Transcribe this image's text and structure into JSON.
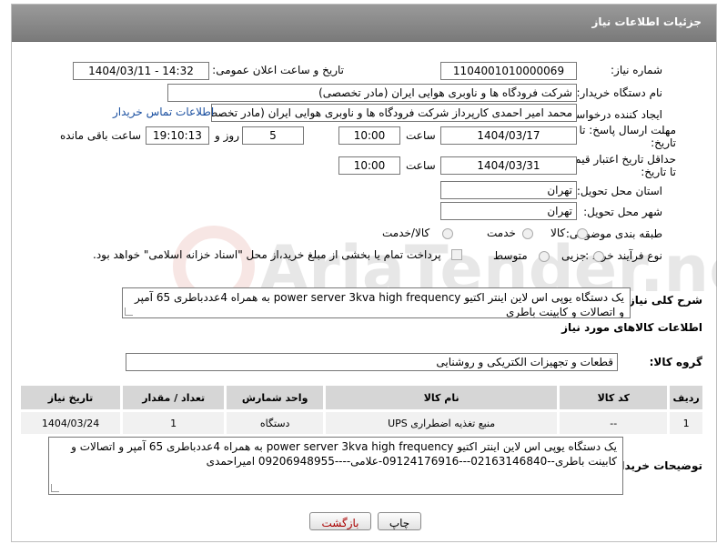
{
  "header": {
    "title": "جزئیات اطلاعات نیاز"
  },
  "form": {
    "need_number_label": "شماره نیاز:",
    "need_number": "1104001010000069",
    "announce_label": "تاریخ و ساعت اعلان عمومی:",
    "announce_value": "1404/03/11 - 14:32",
    "buyer_label": "نام دستگاه خریدار:",
    "buyer_value": "شرکت فرودگاه ها و ناوبری هوایی ایران (مادر تخصصی)",
    "requester_label": "ایجاد کننده درخواست:",
    "requester_value": "محمد امیر احمدی کارپرداز شرکت فرودگاه ها و ناوبری هوایی ایران (مادر تخصصی)",
    "contact_link": "اطلاعات تماس خریدار",
    "deadline_label": "مهلت ارسال پاسخ: تا تاریخ:",
    "deadline_date": "1404/03/17",
    "time_label": "ساعت",
    "deadline_time": "10:00",
    "days_value": "5",
    "days_label": "روز و",
    "remaining_time": "19:10:13",
    "remaining_label": "ساعت باقی مانده",
    "validity_label": "حداقل تاریخ اعتبار قیمت: تا تاریخ:",
    "validity_date": "1404/03/31",
    "validity_time_label": "ساعت",
    "validity_time": "10:00",
    "province_label": "استان محل تحویل:",
    "province_value": "تهران",
    "city_label": "شهر محل تحویل:",
    "city_value": "تهران",
    "category_label": "طبقه بندی موضوعی:",
    "category_options": [
      "کالا",
      "خدمت",
      "کالا/خدمت"
    ],
    "process_label": "نوع فرآیند خرید :",
    "process_options": [
      "جزیی",
      "متوسط"
    ],
    "payment_note": "پرداخت تمام یا بخشی از مبلغ خرید،از محل \"اسناد خزانه اسلامی\" خواهد بود."
  },
  "summary": {
    "label": "شرح کلی نیاز:",
    "text": "یک دستگاه یوپی اس لاین اینتر اکتیو power server 3kva high frequency به همراه 4عددباطری 65 آمپر و اتصالات و کابینت باطری"
  },
  "goods": {
    "section_title": "اطلاعات کالاهای مورد نیاز",
    "group_label": "گروه کالا:",
    "group_value": "قطعات و تجهیزات الکتریکی و روشنایی",
    "columns": [
      "ردیف",
      "کد کالا",
      "نام کالا",
      "واحد شمارش",
      "تعداد / مقدار",
      "تاریخ نیاز"
    ],
    "rows": [
      {
        "row": "1",
        "code": "--",
        "name": "منبع تغذیه اضطراری UPS",
        "unit": "دستگاه",
        "qty": "1",
        "date": "1404/03/24"
      }
    ]
  },
  "buyer_notes": {
    "label": "توضیحات خریدار:",
    "text": "یک دستگاه یوپی اس لاین اینتر اکتیو power server 3kva high frequency به همراه 4عددباطری 65 آمپر و اتصالات و کابینت باطری--02163146840---09124176916-علامی----09206948955 امیراحمدی"
  },
  "buttons": {
    "print": "چاپ",
    "back": "بازگشت"
  },
  "watermark": "AriaTender.neT"
}
